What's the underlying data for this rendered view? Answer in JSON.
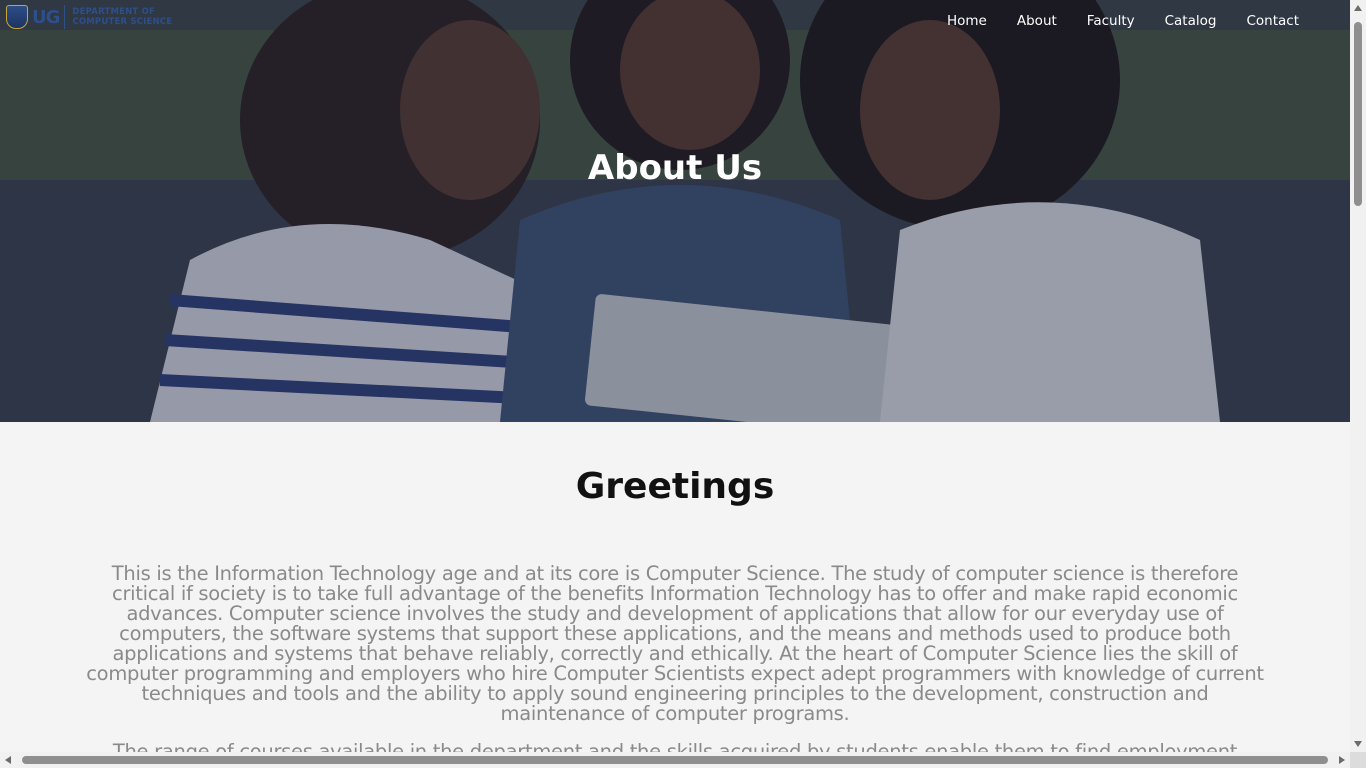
{
  "logo": {
    "abbr": "UG",
    "line1": "DEPARTMENT OF",
    "line2": "COMPUTER SCIENCE"
  },
  "nav": {
    "items": [
      "Home",
      "About",
      "Faculty",
      "Catalog",
      "Contact"
    ]
  },
  "hero": {
    "title": "About Us"
  },
  "main": {
    "heading": "Greetings",
    "paragraph1": "This is the Information Technology age and at its core is Computer Science. The study of computer science is therefore critical if society is to take full advantage of the benefits Information Technology has to offer and make rapid economic advances. Computer science involves the study and development of applications that allow for our everyday use of computers, the software systems that support these applications, and the means and methods used to produce both applications and systems that behave reliably, correctly and ethically. At the heart of Computer Science lies the skill of computer programming and employers who hire Computer Scientists expect adept programmers with knowledge of current techniques and tools and the ability to apply sound engineering principles to the development, construction and maintenance of computer programs.",
    "paragraph2": "The range of courses available in the department and the skills acquired by students enable them to find employment"
  }
}
